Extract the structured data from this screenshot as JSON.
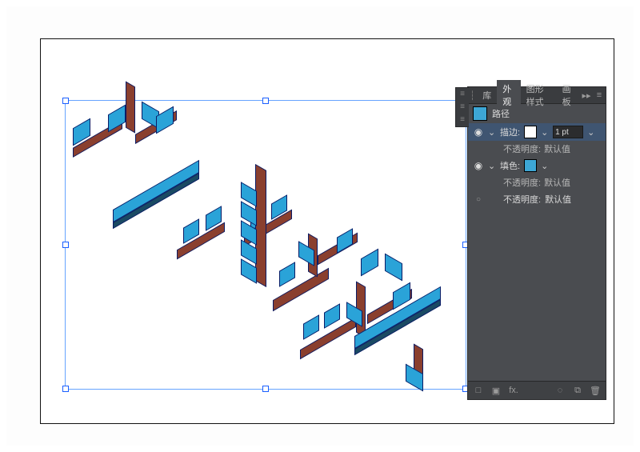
{
  "panel": {
    "tabs": {
      "library": "库",
      "appearance": "外观",
      "graphicStyles": "图形样式",
      "layers": "画板"
    },
    "headerLabel": "路径",
    "rows": {
      "stroke": {
        "label": "描边:",
        "weight": "1 pt"
      },
      "fill": {
        "label": "填色:"
      },
      "sub": {
        "label": "不透明度:",
        "value": "默认值"
      },
      "opacity": {
        "label": "不透明度:",
        "value": "默认值"
      }
    },
    "footer": {
      "fx": "fx."
    }
  },
  "icons": {
    "eye": "◉",
    "ring": "○",
    "drop": "⌄",
    "collapse": "▸▸",
    "menu": "≡",
    "square": "□",
    "sun": "◌",
    "trash": "🗑",
    "new": "⧉"
  }
}
